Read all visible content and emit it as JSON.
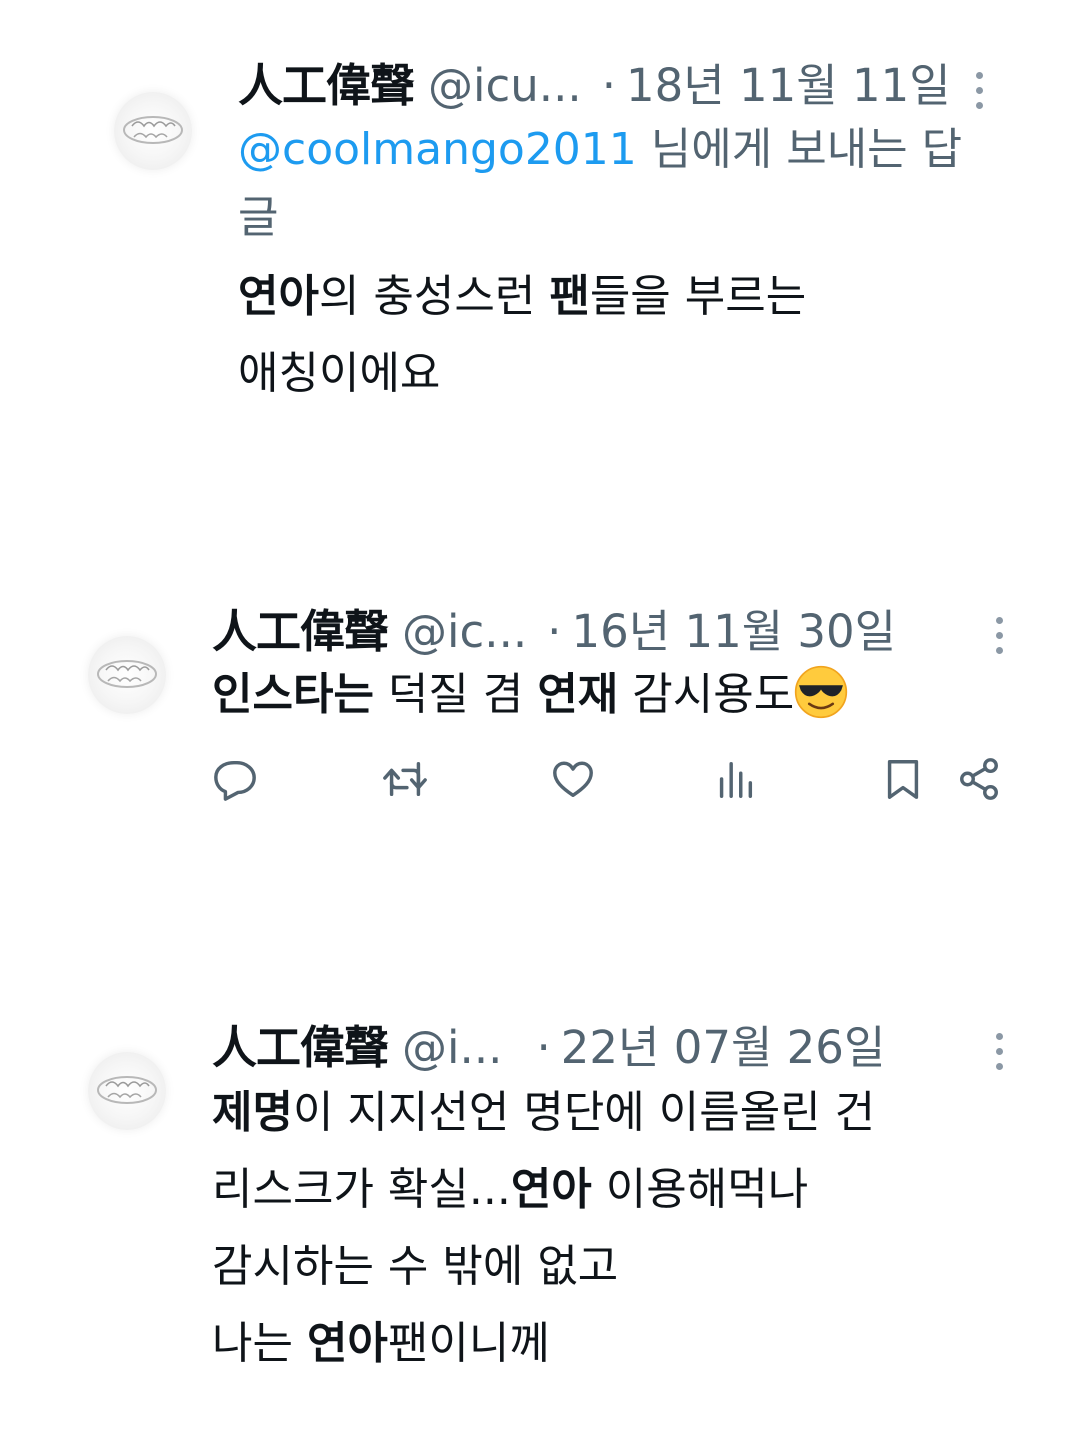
{
  "tweets": [
    {
      "author_name": "人工偉聲",
      "handle": "@icu...",
      "separator": "·",
      "date": "18년 11월 11일",
      "reply_to": {
        "mention": "@coolmango2011",
        "suffix": " 님에게 보내는 답글"
      },
      "body_line1": {
        "b1": "연아",
        "t1": "의 충성스런 ",
        "b2": "팬",
        "t2": "들을 부르는"
      },
      "body_line2": "애칭이에요"
    },
    {
      "author_name": "人工偉聲",
      "handle": "@ic...",
      "separator": "·",
      "date": "16년 11월 30일",
      "body_line1": {
        "b1": "인스타는",
        "t1": " 덕질 겸 ",
        "b2": "연재",
        "t2": " 감시용도"
      },
      "emoji": "smiling-face-with-sunglasses",
      "actions": [
        "reply",
        "retweet",
        "like",
        "views",
        "bookmark",
        "share"
      ]
    },
    {
      "author_name": "人工偉聲",
      "handle": "@i...",
      "separator": "·",
      "date": "22년 07월 26일",
      "line1": {
        "b1": "제명",
        "t1": "이 지지선언 명단에 이름올린 건"
      },
      "line2": {
        "t1": "리스크가 확실...",
        "b1": "연아",
        "t2": " 이용해먹나"
      },
      "line3": "감시하는 수 밖에 없고",
      "line4": {
        "t1": "나는 ",
        "b1": "연아",
        "t2": "팬이니께"
      }
    }
  ],
  "colors": {
    "text": "#0f1419",
    "secondary": "#536471",
    "link": "#1d9bf0"
  }
}
